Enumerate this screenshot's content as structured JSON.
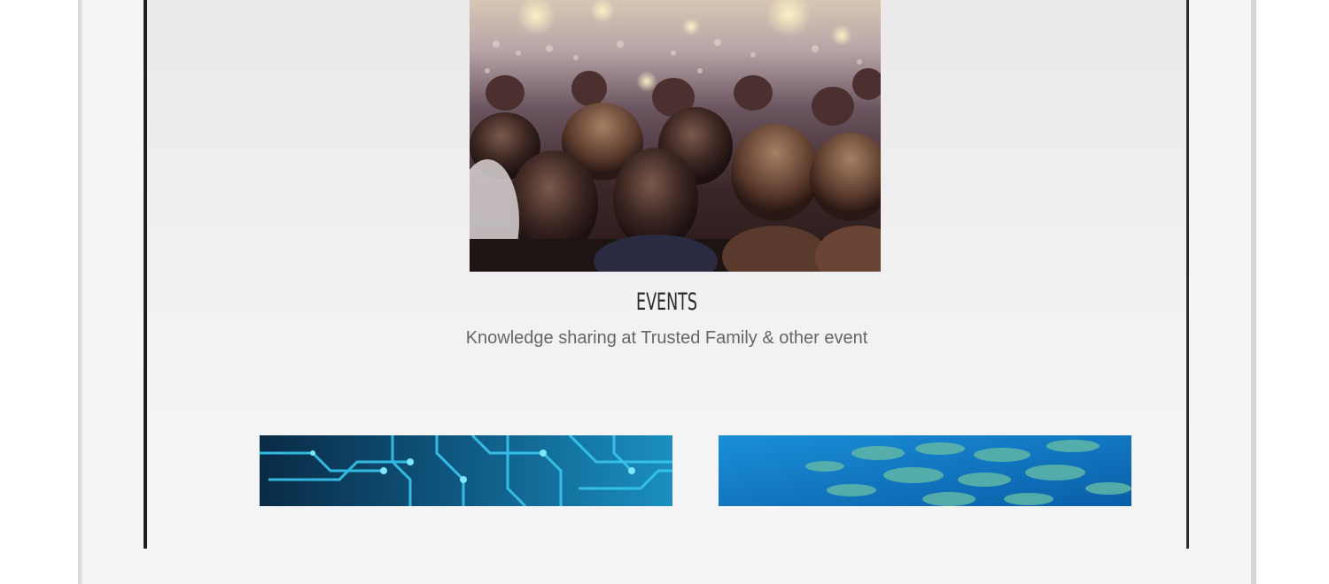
{
  "events": {
    "title": "EVENTS",
    "subtitle": "Knowledge sharing at Trusted Family & other event"
  },
  "images": [
    {
      "name": "events-crowd-photo"
    },
    {
      "name": "circuit-board-photo"
    },
    {
      "name": "fish-school-photo"
    }
  ],
  "colors": {
    "screen_bezel": "#1e1e1e",
    "device_body": "#f4f5f7",
    "title_text": "#2b2b2b",
    "subtitle_text": "#666666"
  }
}
